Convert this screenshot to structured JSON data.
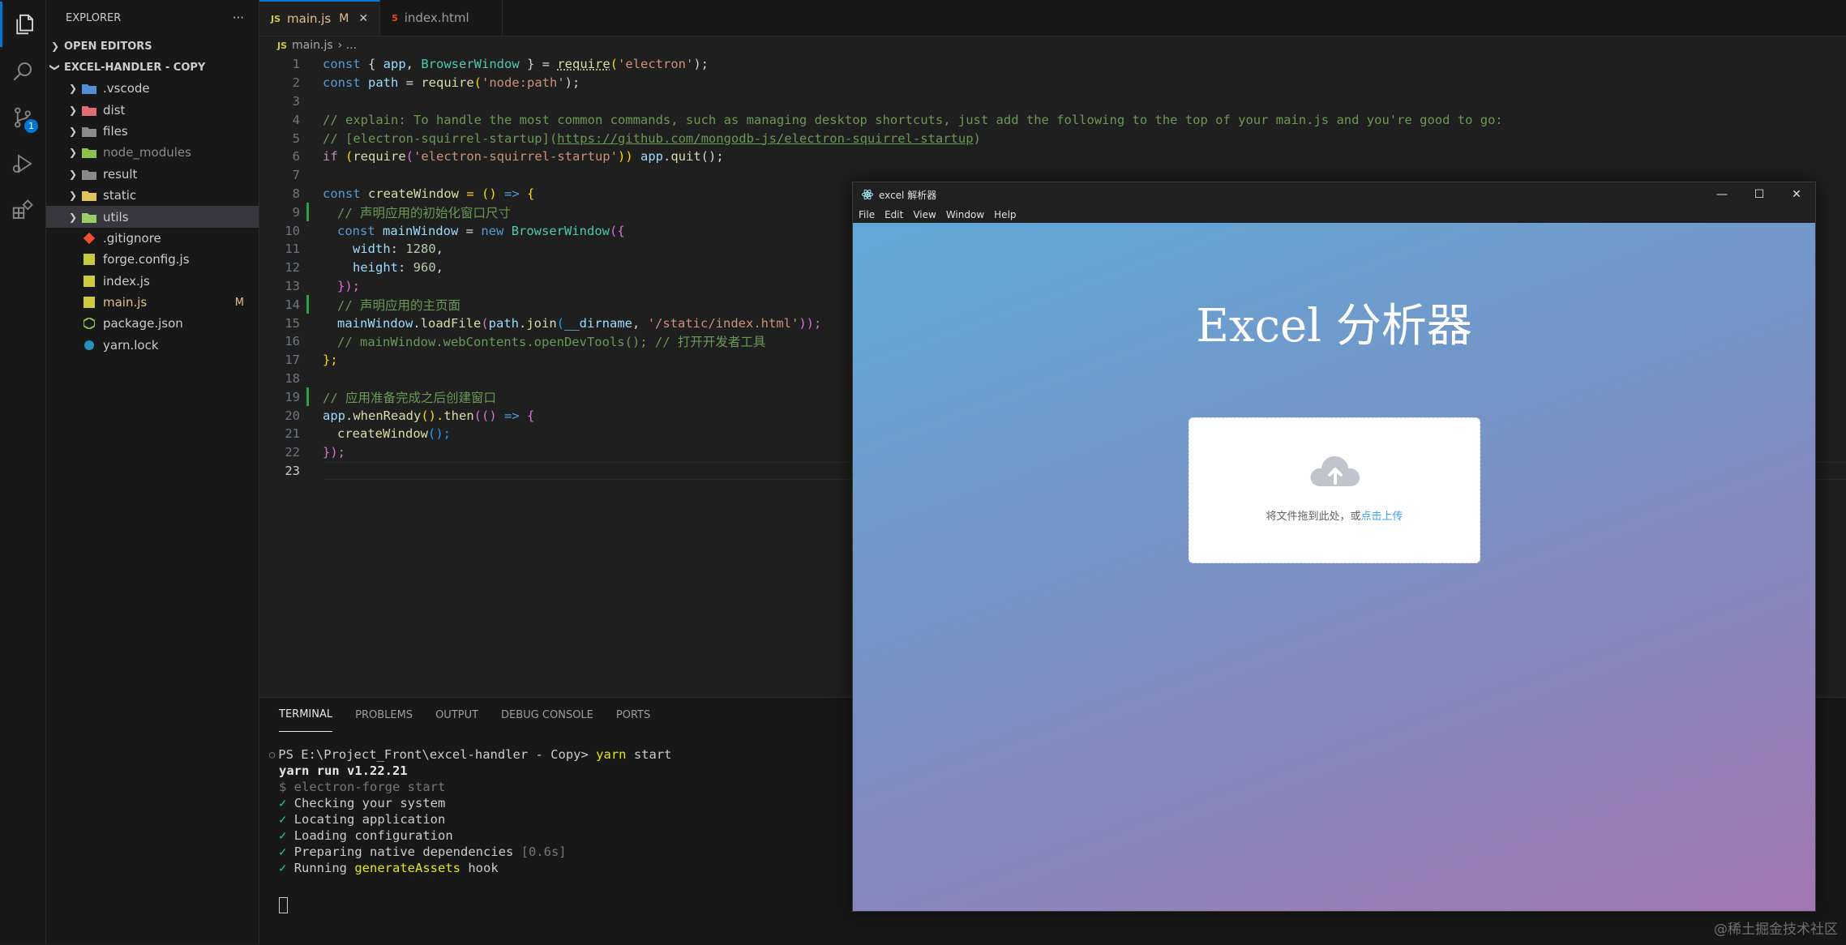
{
  "sidebar": {
    "explorer_title": "EXPLORER",
    "more": "···",
    "open_editors": "OPEN EDITORS",
    "project": "EXCEL-HANDLER - COPY",
    "items": [
      {
        "label": ".vscode",
        "type": "folder"
      },
      {
        "label": "dist",
        "type": "folder"
      },
      {
        "label": "files",
        "type": "folder"
      },
      {
        "label": "node_modules",
        "type": "folder"
      },
      {
        "label": "result",
        "type": "folder"
      },
      {
        "label": "static",
        "type": "folder"
      },
      {
        "label": "utils",
        "type": "folder"
      },
      {
        "label": ".gitignore",
        "type": "file"
      },
      {
        "label": "forge.config.js",
        "type": "file"
      },
      {
        "label": "index.js",
        "type": "file"
      },
      {
        "label": "main.js",
        "type": "file",
        "modified": "M"
      },
      {
        "label": "package.json",
        "type": "file"
      },
      {
        "label": "yarn.lock",
        "type": "file"
      }
    ]
  },
  "activity": {
    "scm_badge": "1"
  },
  "tabs": [
    {
      "icon": "JS",
      "label": "main.js",
      "modified": "M",
      "close": "✕"
    },
    {
      "icon": "5",
      "label": "index.html"
    }
  ],
  "breadcrumb": {
    "icon": "JS",
    "file": "main.js",
    "sep": "› ..."
  },
  "code": {
    "l1": {
      "n": "1",
      "a": "const",
      "b": " { ",
      "c": "app",
      "d": ", ",
      "e": "BrowserWindow",
      "f": " } = ",
      "g": "require",
      "h": "(",
      "i": "'electron'",
      "j": ");"
    },
    "l2": {
      "n": "2",
      "a": "const",
      "b": " ",
      "c": "path",
      "d": " = ",
      "e": "require",
      "f": "(",
      "g": "'node:path'",
      "h": ");"
    },
    "l3": {
      "n": "3"
    },
    "l4": {
      "n": "4",
      "a": "// explain: To handle the most common commands, such as managing desktop shortcuts, just add the following to the top of your main.js and you're good to go:"
    },
    "l5": {
      "n": "5",
      "a": "// [electron-squirrel-startup](",
      "b": "https://github.com/mongodb-js/electron-squirrel-startup",
      "c": ")"
    },
    "l6": {
      "n": "6",
      "a": "if",
      "b": " (",
      "c": "require",
      "d": "(",
      "e": "'electron-squirrel-startup'",
      "f": ")) ",
      "g": "app",
      "h": ".",
      "i": "quit",
      "j": "();"
    },
    "l7": {
      "n": "7"
    },
    "l8": {
      "n": "8",
      "a": "const",
      "b": " ",
      "c": "createWindow",
      "d": " = () ",
      "e": "=>",
      "f": " {"
    },
    "l9": {
      "n": "9",
      "a": "// 声明应用的初始化窗口尺寸"
    },
    "l10": {
      "n": "10",
      "a": "const",
      "b": " ",
      "c": "mainWindow",
      "d": " = ",
      "e": "new",
      "f": " ",
      "g": "BrowserWindow",
      "h": "({"
    },
    "l11": {
      "n": "11",
      "a": "width",
      "b": ": ",
      "c": "1280",
      "d": ","
    },
    "l12": {
      "n": "12",
      "a": "height",
      "b": ": ",
      "c": "960",
      "d": ","
    },
    "l13": {
      "n": "13",
      "a": "});"
    },
    "l14": {
      "n": "14",
      "a": "// 声明应用的主页面"
    },
    "l15": {
      "n": "15",
      "a": "mainWindow",
      "b": ".",
      "c": "loadFile",
      "d": "(",
      "e": "path",
      "f": ".",
      "g": "join",
      "h": "(",
      "i": "__dirname",
      "j": ", ",
      "k": "'/static/index.html'",
      "l": "));"
    },
    "l16": {
      "n": "16",
      "a": "// mainWindow.webContents.openDevTools(); // 打开开发者工具"
    },
    "l17": {
      "n": "17",
      "a": "};"
    },
    "l18": {
      "n": "18"
    },
    "l19": {
      "n": "19",
      "a": "// 应用准备完成之后创建窗口"
    },
    "l20": {
      "n": "20",
      "a": "app",
      "b": ".",
      "c": "whenReady",
      "d": "().",
      "e": "then",
      "f": "(() ",
      "g": "=>",
      "h": " {"
    },
    "l21": {
      "n": "21",
      "a": "createWindow",
      "b": "();"
    },
    "l22": {
      "n": "22",
      "a": "});"
    },
    "l23": {
      "n": "23"
    }
  },
  "panel": {
    "tabs": [
      "TERMINAL",
      "PROBLEMS",
      "OUTPUT",
      "DEBUG CONSOLE",
      "PORTS"
    ],
    "prompt_dot": "○",
    "prompt": "PS E:\\Project_Front\\excel-handler - Copy> ",
    "cmd_a": "yarn",
    "cmd_b": " start",
    "yarn_run": "yarn run v1.22.21",
    "forge": "$ electron-forge start",
    "check": "✓",
    "steps": [
      "Checking your system",
      "Locating application",
      "Loading configuration",
      "Preparing native dependencies"
    ],
    "step4_time": " [0.6s]",
    "step5_a": "Running ",
    "step5_b": "generateAssets",
    "step5_c": " hook"
  },
  "app": {
    "title": "excel 解析器",
    "minimize": "—",
    "maximize": "☐",
    "close": "✕",
    "menu": [
      "File",
      "Edit",
      "View",
      "Window",
      "Help"
    ],
    "heading": "Excel 分析器",
    "upload_text": "将文件拖到此处，或",
    "upload_link": "点击上传"
  },
  "watermark": "@稀土掘金技术社区"
}
